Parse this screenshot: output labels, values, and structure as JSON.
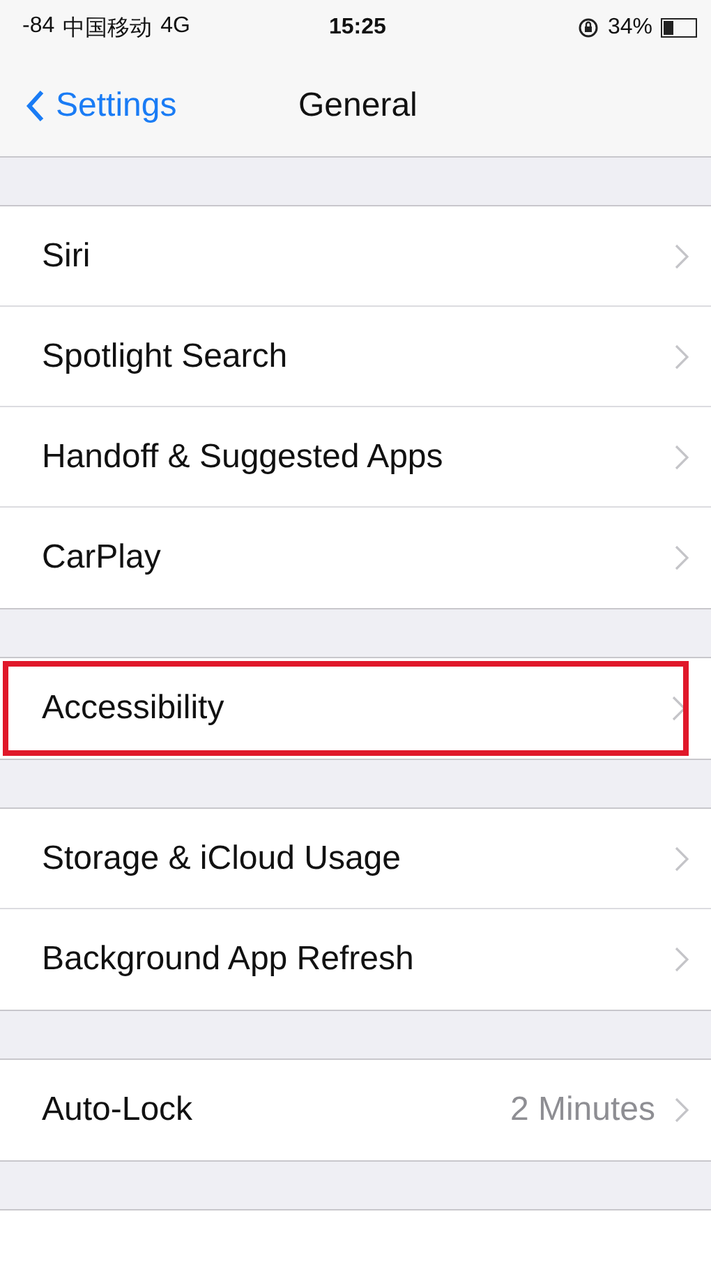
{
  "status_bar": {
    "signal": "-84",
    "carrier": "中国移动",
    "network": "4G",
    "time": "15:25",
    "battery": "34%"
  },
  "nav_bar": {
    "back": "Settings",
    "title": "General"
  },
  "sections": [
    {
      "items": [
        {
          "label": "Siri",
          "highlighted": false
        },
        {
          "label": "Spotlight Search",
          "highlighted": false
        },
        {
          "label": "Handoff & Suggested Apps",
          "highlighted": false
        },
        {
          "label": "CarPlay",
          "highlighted": false
        }
      ]
    },
    {
      "items": [
        {
          "label": "Accessibility",
          "highlighted": true
        }
      ]
    },
    {
      "items": [
        {
          "label": "Storage & iCloud Usage",
          "highlighted": false
        },
        {
          "label": "Background App Refresh",
          "highlighted": false
        }
      ]
    },
    {
      "items": [
        {
          "label": "Auto-Lock",
          "value": "2 Minutes",
          "highlighted": false
        }
      ]
    }
  ]
}
